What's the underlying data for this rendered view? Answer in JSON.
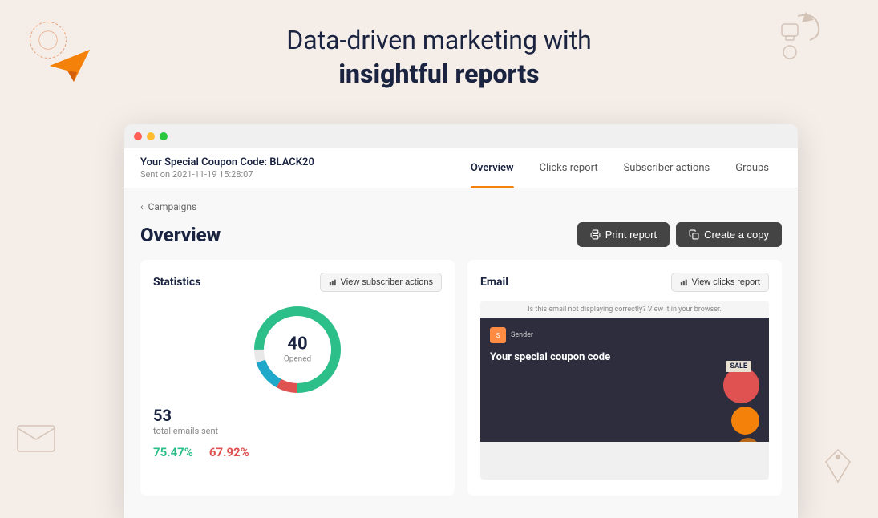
{
  "background_color": "#f5ede8",
  "header": {
    "line1": "Data-driven marketing with",
    "line2": "insightful reports"
  },
  "browser": {
    "dots": [
      "red",
      "yellow",
      "green"
    ]
  },
  "navbar": {
    "campaign_title": "Your Special Coupon Code: BLACK20",
    "campaign_date": "Sent on 2021-11-19 15:28:07",
    "tabs": [
      {
        "label": "Overview",
        "active": true
      },
      {
        "label": "Clicks report",
        "active": false
      },
      {
        "label": "Subscriber actions",
        "active": false
      },
      {
        "label": "Groups",
        "active": false
      }
    ]
  },
  "breadcrumb": {
    "arrow": "‹",
    "text": "Campaigns"
  },
  "content": {
    "title": "Overview",
    "actions": [
      {
        "label": "Print report",
        "icon": "print"
      },
      {
        "label": "Create a copy",
        "icon": "copy"
      }
    ]
  },
  "statistics_card": {
    "title": "Statistics",
    "action_label": "View subscriber actions",
    "donut": {
      "number": "40",
      "label": "Opened",
      "segments": [
        {
          "color": "#2dbf8a",
          "pct": 75
        },
        {
          "color": "#e05252",
          "pct": 8
        },
        {
          "color": "#1fa8c9",
          "pct": 12
        },
        {
          "color": "#e0e0e0",
          "pct": 5
        }
      ]
    },
    "total_emails": "53",
    "total_label": "total emails sent",
    "pct1": "75.47%",
    "pct2": "67.92%"
  },
  "email_card": {
    "title": "Email",
    "action_label": "View clicks report",
    "preview": {
      "top_text": "Is this email not displaying correctly? View it in your browser.",
      "brand": "Sender",
      "email_title": "Your special coupon code",
      "sale_badge": "SALE"
    }
  }
}
